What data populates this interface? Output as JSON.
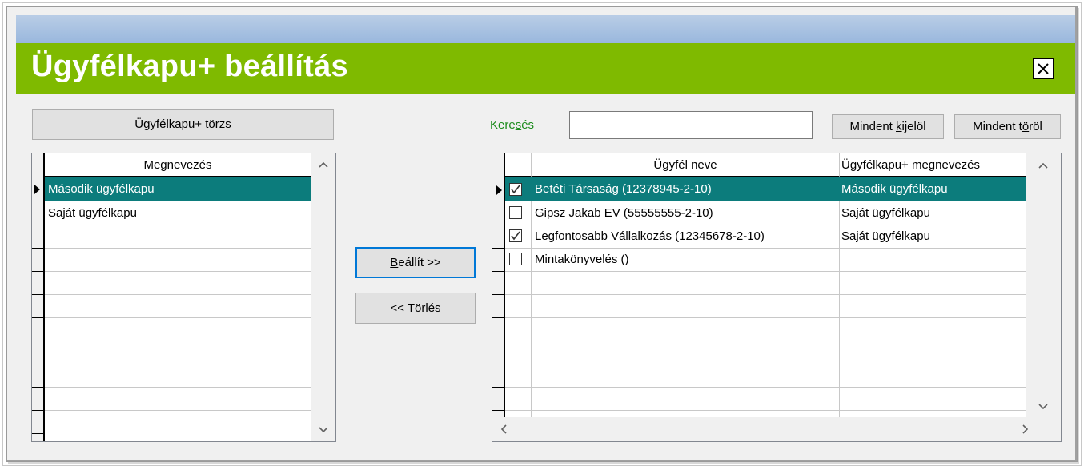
{
  "window": {
    "title": "Ügyfélkapu+ beállítás"
  },
  "left": {
    "torzs_button": {
      "prefix": "",
      "underline": "Ü",
      "rest": "gyfélkapu+ törzs"
    },
    "grid": {
      "header": "Megnevezés",
      "rows": [
        "Második ügyfélkapu",
        "Saját ügyfélkapu"
      ],
      "selected_index": 0
    }
  },
  "middle": {
    "set_button": {
      "underline": "B",
      "rest": "eállít >>"
    },
    "delete_button": {
      "prefix": "<< ",
      "underline": "T",
      "rest": "örlés"
    }
  },
  "right": {
    "search": {
      "label_pre": "Kere",
      "label_u": "s",
      "label_post": "és",
      "value": ""
    },
    "select_all_button": {
      "prefix": "Mindent ",
      "underline": "k",
      "rest": "ijelöl"
    },
    "clear_all_button": {
      "prefix": "Mindent t",
      "underline": "ö",
      "rest": "röl"
    },
    "grid": {
      "headers": [
        "Ügyfél neve",
        "Ügyfélkapu+ megnevezés"
      ],
      "rows": [
        {
          "checked": true,
          "name": "Betéti Társaság (12378945-2-10)",
          "kapu": "Második ügyfélkapu"
        },
        {
          "checked": false,
          "name": "Gipsz Jakab EV (55555555-2-10)",
          "kapu": "Saját ügyfélkapu"
        },
        {
          "checked": true,
          "name": "Legfontosabb Vállalkozás (12345678-2-10)",
          "kapu": "Saját ügyfélkapu"
        },
        {
          "checked": false,
          "name": "Mintakönyvelés ()",
          "kapu": ""
        }
      ],
      "selected_index": 0
    }
  },
  "colors": {
    "title_green": "#7fba00",
    "selection": "#0c7c7c",
    "label_green": "#1c8c1c",
    "focus_blue": "#0078d7"
  }
}
